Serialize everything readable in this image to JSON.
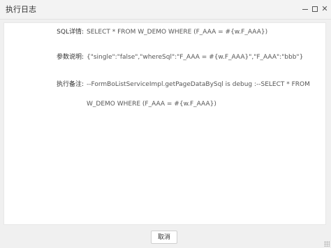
{
  "window": {
    "title": "执行日志",
    "minimize_icon": "minimize-icon",
    "maximize_icon": "maximize-icon",
    "close_icon": "close-icon",
    "close_glyph": "✕"
  },
  "log": {
    "sql_label": "SQL详情:",
    "sql_value": "SELECT * FROM W_DEMO WHERE (F_AAA = #{w.F_AAA})",
    "params_label": "参数说明:",
    "params_value": "{\"single\":\"false\",\"whereSql\":\"F_AAA = #{w.F_AAA}\",\"F_AAA\":\"bbb\"}",
    "remark_label": "执行备注:",
    "remark_value": "--FormBoListServiceImpl.getPageDataBySql is debug :--SELECT * FROM W_DEMO WHERE (F_AAA = #{w.F_AAA})"
  },
  "footer": {
    "cancel_label": "取消"
  }
}
